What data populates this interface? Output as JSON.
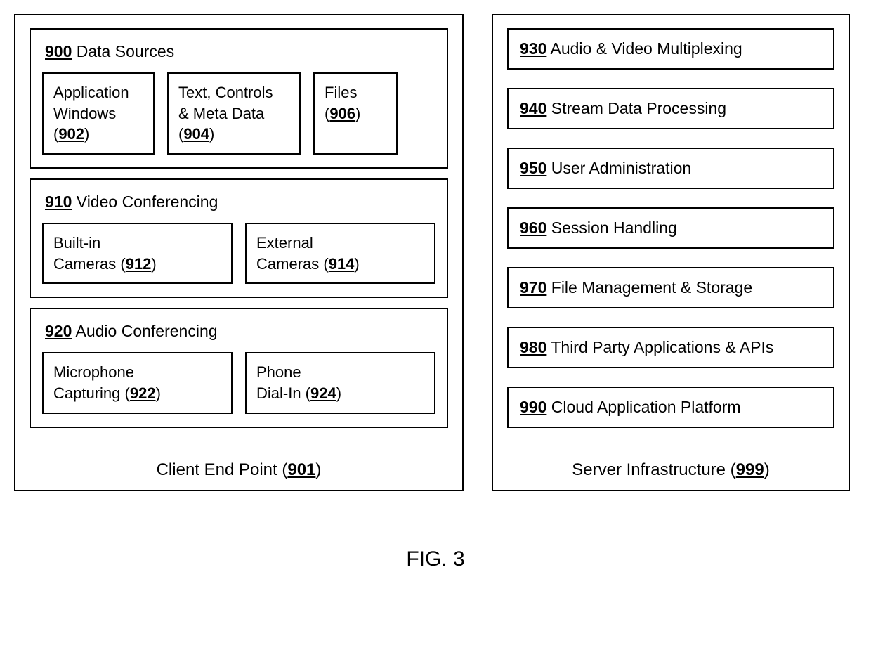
{
  "figure_label": "FIG. 3",
  "client": {
    "caption_prefix": "Client End Point (",
    "caption_num": "901",
    "caption_suffix": ")",
    "data_sources": {
      "num": "900",
      "title": " Data Sources",
      "app_windows": {
        "line1": "Application",
        "line2": "Windows",
        "num": "902"
      },
      "text_meta": {
        "line1": "Text, Controls",
        "line2": "& Meta Data",
        "num": "904"
      },
      "files": {
        "line1": "Files",
        "num": "906"
      }
    },
    "video": {
      "num": "910",
      "title": " Video Conferencing",
      "builtin": {
        "line1": "Built-in",
        "line2": "Cameras (",
        "num": "912",
        "suffix": ")"
      },
      "external": {
        "line1": "External",
        "line2": "Cameras (",
        "num": "914",
        "suffix": ")"
      }
    },
    "audio": {
      "num": "920",
      "title": " Audio Conferencing",
      "mic": {
        "line1": "Microphone",
        "line2": "Capturing (",
        "num": "922",
        "suffix": ")"
      },
      "dialin": {
        "line1": "Phone",
        "line2": "Dial-In (",
        "num": "924",
        "suffix": ")"
      }
    }
  },
  "server": {
    "caption_prefix": "Server Infrastructure (",
    "caption_num": "999",
    "caption_suffix": ")",
    "items": [
      {
        "num": "930",
        "label": " Audio & Video Multiplexing"
      },
      {
        "num": "940",
        "label": " Stream Data Processing"
      },
      {
        "num": "950",
        "label": " User Administration"
      },
      {
        "num": "960",
        "label": " Session Handling"
      },
      {
        "num": "970",
        "label": " File Management & Storage"
      },
      {
        "num": "980",
        "label": " Third Party Applications & APIs"
      },
      {
        "num": "990",
        "label": " Cloud Application Platform"
      }
    ]
  }
}
